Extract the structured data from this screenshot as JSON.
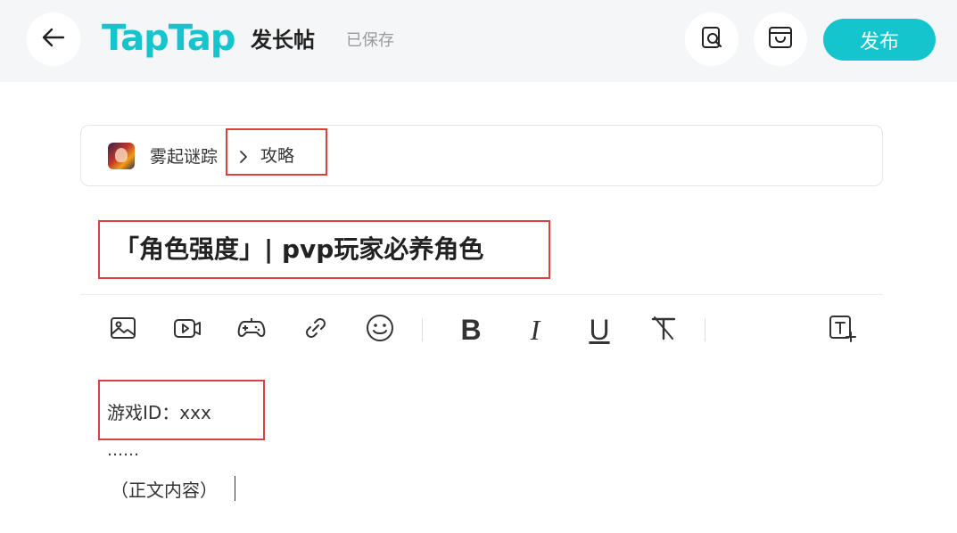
{
  "header": {
    "logo_text": "TapTap",
    "page_title": "发长帖",
    "saved_status": "已保存",
    "publish_label": "发布",
    "back_icon": "arrow-left-icon",
    "preview_icon": "preview-search-icon",
    "draft_icon": "draft-box-icon",
    "accent_color": "#15c5ce"
  },
  "breadcrumb": {
    "game_name": "雾起谜踪",
    "category": "攻略"
  },
  "post": {
    "title": "「角色强度」| pvp玩家必养角色"
  },
  "toolbar": {
    "items": [
      {
        "name": "image-icon"
      },
      {
        "name": "video-icon"
      },
      {
        "name": "game-controller-icon"
      },
      {
        "name": "link-icon"
      },
      {
        "name": "emoji-icon"
      },
      {
        "name": "bold-icon",
        "label": "B"
      },
      {
        "name": "italic-icon",
        "label": "I"
      },
      {
        "name": "underline-icon",
        "label": "U"
      },
      {
        "name": "clear-format-icon"
      },
      {
        "name": "text-insert-icon"
      }
    ]
  },
  "content": {
    "line1": "游戏ID：xxx",
    "line2": "……",
    "line3": "（正文内容）"
  }
}
